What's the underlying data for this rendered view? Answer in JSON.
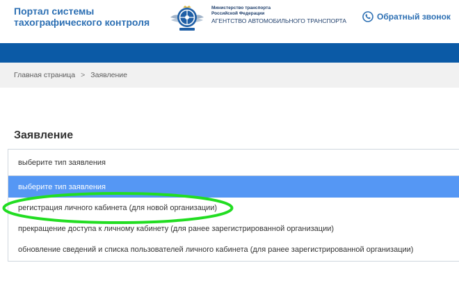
{
  "header": {
    "portal_title_line1": "Портал системы",
    "portal_title_line2": "тахографического контроля",
    "agency_line1": "Министерство транспорта",
    "agency_line2": "Российской Федерации",
    "agency_line3": "АГЕНТСТВО АВТОМОБИЛЬНОГО ТРАНСПОРТА",
    "callback_label": "Обратный звонок",
    "emblem_icon": "agency-emblem-icon",
    "phone_icon": "phone-icon"
  },
  "breadcrumb": {
    "home": "Главная страница",
    "separator": ">",
    "current": "Заявление"
  },
  "page": {
    "title": "Заявление"
  },
  "application_type_select": {
    "selected_value": "выберите тип заявления",
    "options": [
      "выберите тип заявления",
      "регистрация личного кабинета (для новой организации)",
      "прекращение доступа к личному кабинету (для ранее зарегистрированной организации)",
      "обновление сведений и списка пользователей личного кабинета (для ранее зарегистрированной организации)"
    ],
    "highlighted_option_index": 0
  },
  "colors": {
    "brand_blue": "#2c6fb3",
    "nav_band": "#0b5aa6",
    "option_highlight": "#5597f4",
    "annotation_green": "#22dd22"
  }
}
